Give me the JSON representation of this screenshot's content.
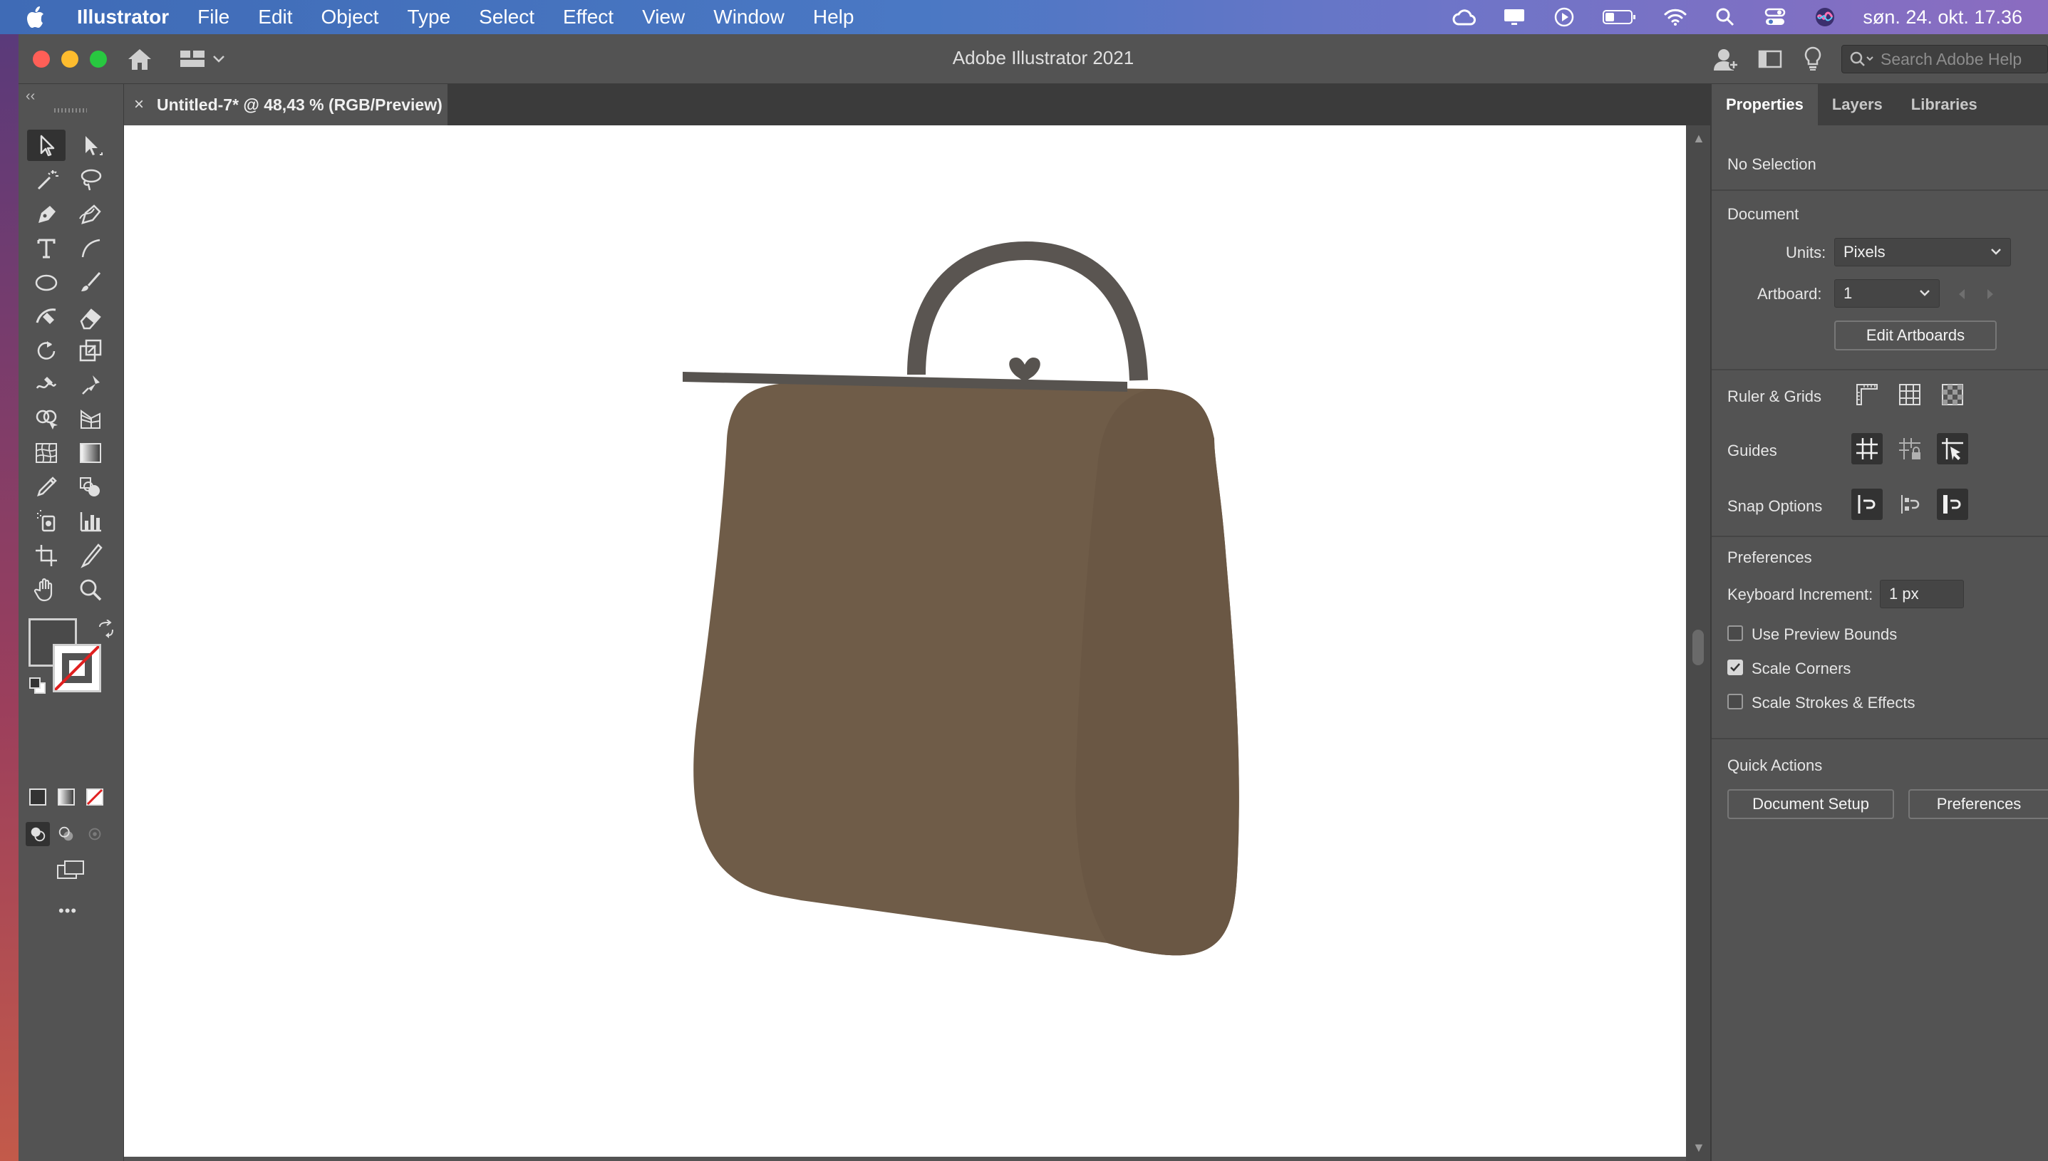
{
  "menubar": {
    "app_name": "Illustrator",
    "items": [
      "File",
      "Edit",
      "Object",
      "Type",
      "Select",
      "Effect",
      "View",
      "Window",
      "Help"
    ],
    "clock": "søn. 24. okt. 17.36",
    "status_icons": [
      "creative-cloud-icon",
      "display-icon",
      "play-icon",
      "battery-icon",
      "wifi-icon",
      "search-icon",
      "control-center-icon",
      "siri-icon"
    ]
  },
  "window": {
    "title": "Adobe Illustrator 2021",
    "search_placeholder": "Search Adobe Help"
  },
  "document_tab": {
    "close": "×",
    "label": "Untitled-7* @ 48,43 % (RGB/Preview)"
  },
  "toolbar": {
    "collapse": "‹‹",
    "more": "•••"
  },
  "panel": {
    "tabs": [
      "Properties",
      "Layers",
      "Libraries"
    ],
    "active_tab": "Properties",
    "selection": "No Selection",
    "document": {
      "heading": "Document",
      "units_label": "Units:",
      "units_value": "Pixels",
      "artboard_label": "Artboard:",
      "artboard_value": "1",
      "edit_artboards": "Edit Artboards"
    },
    "ruler_grids": "Ruler & Grids",
    "guides": "Guides",
    "snap_options": "Snap Options",
    "preferences": {
      "heading": "Preferences",
      "keyboard_increment_label": "Keyboard Increment:",
      "keyboard_increment_value": "1 px",
      "use_preview_bounds": "Use Preview Bounds",
      "use_preview_bounds_checked": false,
      "scale_corners": "Scale Corners",
      "scale_corners_checked": true,
      "scale_strokes": "Scale Strokes & Effects",
      "scale_strokes_checked": false
    },
    "quick_actions": {
      "heading": "Quick Actions",
      "document_setup": "Document Setup",
      "preferences_btn": "Preferences"
    }
  },
  "colors": {
    "bag_body": "#6f5c48",
    "bag_side": "#6a5744",
    "bag_handle": "#5a5551",
    "bag_frame": "#57534f",
    "ui_bg": "#535353"
  }
}
